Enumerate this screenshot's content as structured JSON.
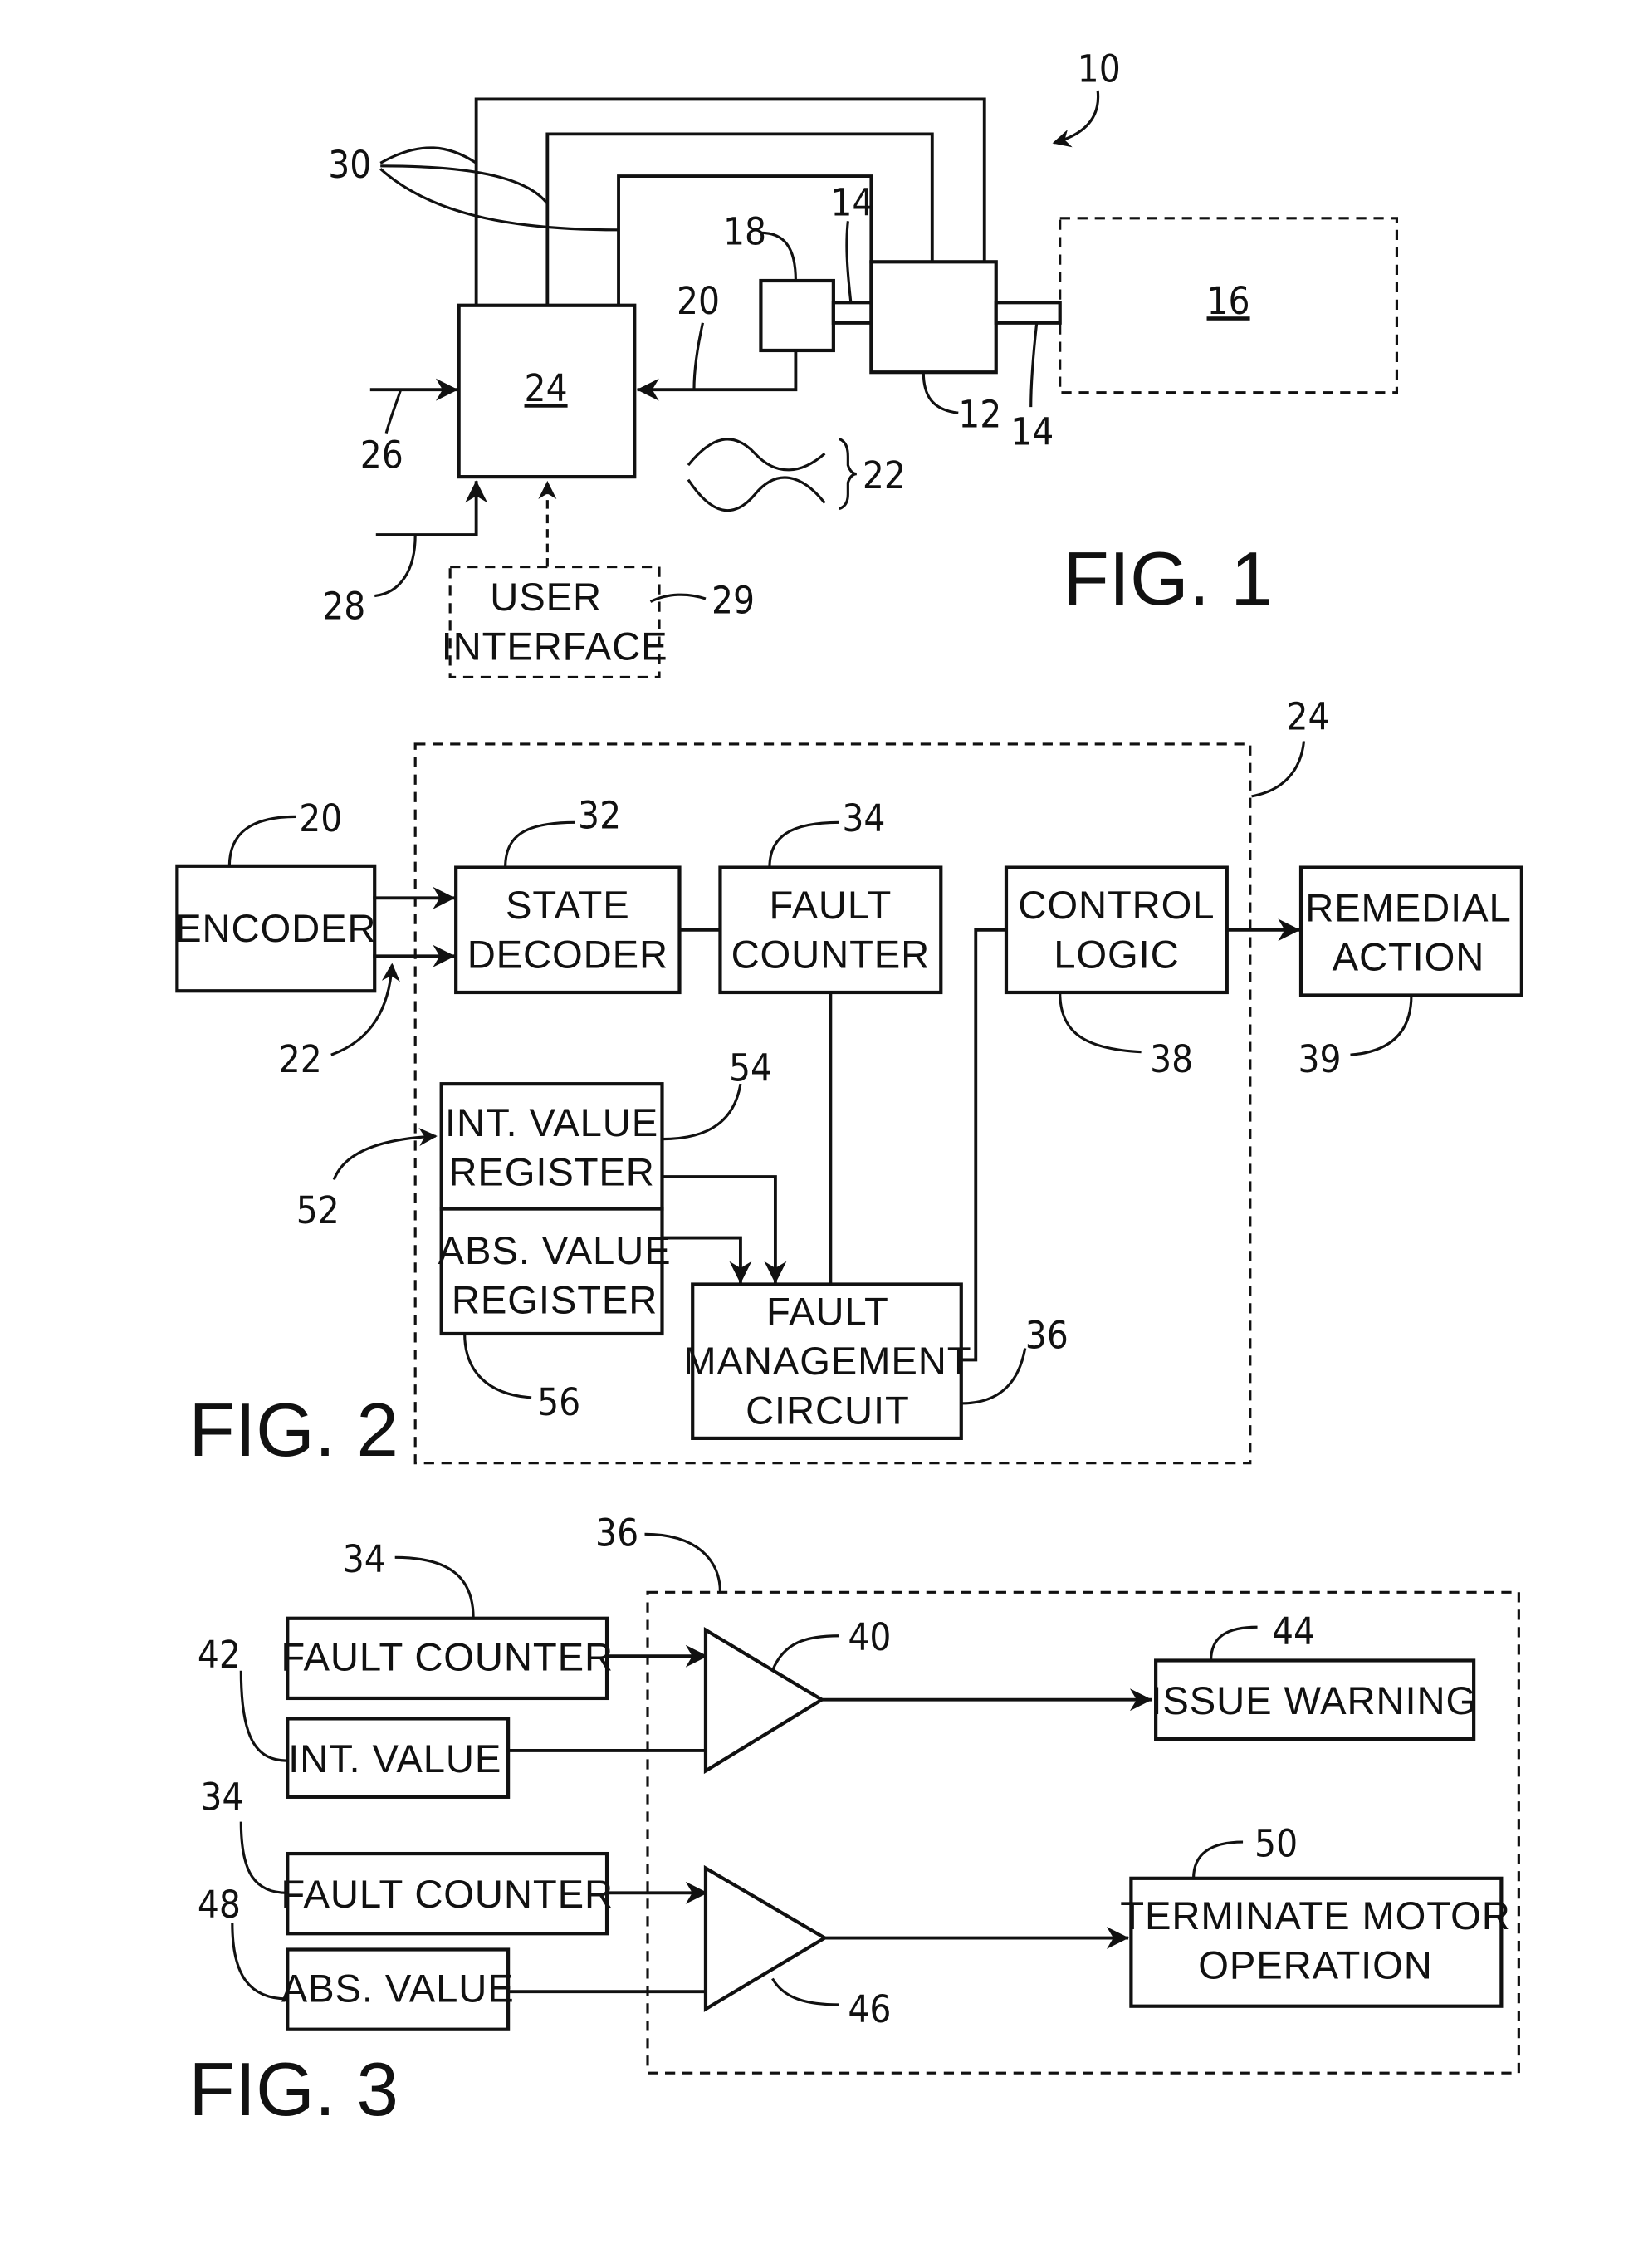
{
  "figures": [
    {
      "id": "fig1",
      "title": "FIG. 1",
      "system_ref": "10",
      "blocks": {
        "controller": "24",
        "motor": "12",
        "encoder": "18",
        "load": "16",
        "user_interface": [
          "USER",
          "INTERFACE"
        ]
      },
      "refs": {
        "conductors": "30",
        "shaft_top": "14",
        "shaft_bottom": "14",
        "encoder_signal": "20",
        "signals": "22",
        "input_26": "26",
        "input_28": "28",
        "user_interface": "29"
      }
    },
    {
      "id": "fig2",
      "title": "FIG. 2",
      "container_ref": "24",
      "blocks": {
        "encoder": [
          "ENCODER"
        ],
        "state_decoder": [
          "STATE",
          "DECODER"
        ],
        "fault_counter": [
          "FAULT",
          "COUNTER"
        ],
        "control_logic": [
          "CONTROL",
          "LOGIC"
        ],
        "remedial_action": [
          "REMEDIAL",
          "ACTION"
        ],
        "int_value_register": [
          "INT. VALUE",
          "REGISTER"
        ],
        "abs_value_register": [
          "ABS. VALUE",
          "REGISTER"
        ],
        "fault_management_circuit": [
          "FAULT",
          "MANAGEMENT",
          "CIRCUIT"
        ]
      },
      "refs": {
        "encoder": "20",
        "signals": "22",
        "state_decoder": "32",
        "fault_counter": "34",
        "control_logic": "38",
        "remedial_action": "39",
        "registers": "52",
        "int_value_register": "54",
        "abs_value_register": "56",
        "fault_management_circuit": "36"
      }
    },
    {
      "id": "fig3",
      "title": "FIG. 3",
      "container_ref": "36",
      "blocks": {
        "fault_counter_1": "FAULT  COUNTER",
        "int_value": "INT. VALUE",
        "fault_counter_2": "FAULT  COUNTER",
        "abs_value": "ABS. VALUE",
        "issue_warning": "ISSUE  WARNING",
        "terminate_motor_operation": [
          "TERMINATE  MOTOR",
          "OPERATION"
        ]
      },
      "refs": {
        "fault_counter_1": "34",
        "int_value": "42",
        "fault_counter_2": "34",
        "abs_value": "48",
        "comparator_1": "40",
        "comparator_2": "46",
        "issue_warning": "44",
        "terminate_motor_operation": "50"
      }
    }
  ]
}
